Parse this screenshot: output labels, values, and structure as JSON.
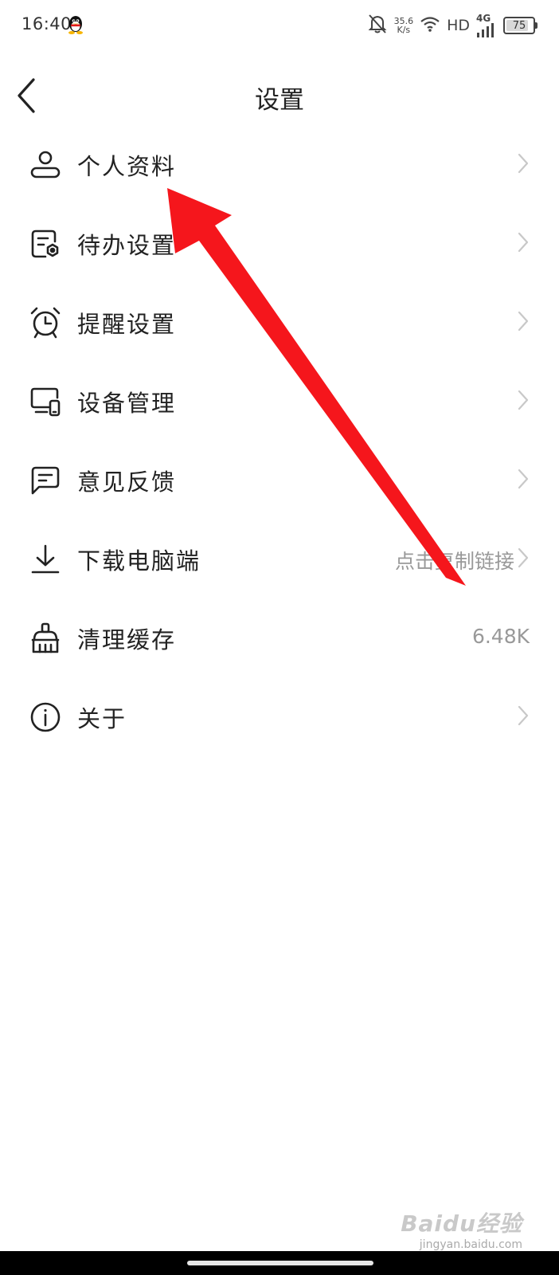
{
  "status_bar": {
    "time": "16:40",
    "net_speed_value": "35.6",
    "net_speed_unit": "K/s",
    "hd_label": "HD",
    "signal_label": "4G",
    "battery_level": "75",
    "icons": [
      "qq-icon",
      "bell-mute-icon",
      "wifi-icon",
      "signal-icon",
      "battery-icon"
    ]
  },
  "header": {
    "title": "设置",
    "back_icon": "chevron-left-icon"
  },
  "menu": {
    "items": [
      {
        "label": "个人资料",
        "icon": "user-icon",
        "value": "",
        "chevron": true
      },
      {
        "label": "待办设置",
        "icon": "todo-settings-icon",
        "value": "",
        "chevron": true
      },
      {
        "label": "提醒设置",
        "icon": "alarm-clock-icon",
        "value": "",
        "chevron": true
      },
      {
        "label": "设备管理",
        "icon": "devices-icon",
        "value": "",
        "chevron": true
      },
      {
        "label": "意见反馈",
        "icon": "feedback-icon",
        "value": "",
        "chevron": true
      },
      {
        "label": "下载电脑端",
        "icon": "download-icon",
        "value": "点击复制链接",
        "chevron": true
      },
      {
        "label": "清理缓存",
        "icon": "broom-icon",
        "value": "6.48K",
        "chevron": false
      },
      {
        "label": "关于",
        "icon": "info-icon",
        "value": "",
        "chevron": true
      }
    ]
  },
  "watermark": {
    "logo": "Baidu经验",
    "url": "jingyan.baidu.com"
  },
  "colors": {
    "annotation_arrow": "#f5161c",
    "text_primary": "#222222",
    "text_secondary": "#999999",
    "chevron": "#c8c8c8"
  }
}
